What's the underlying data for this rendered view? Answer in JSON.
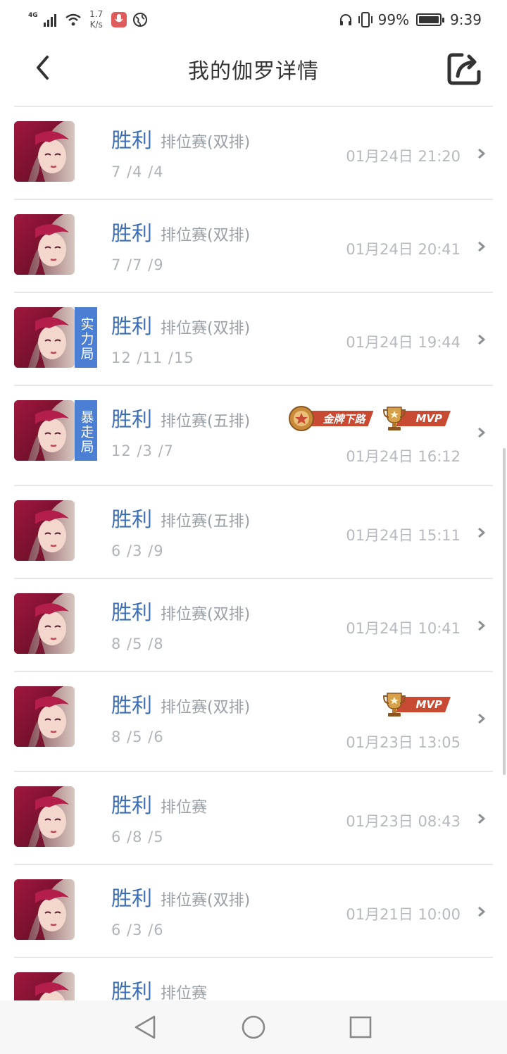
{
  "status_bar": {
    "network": "4G",
    "speed": "1.7",
    "speed_unit": "K/s",
    "battery": "99%",
    "time": "9:39"
  },
  "header": {
    "title": "我的伽罗详情"
  },
  "matches": [
    {
      "result": "胜利",
      "mode": "排位赛(双排)",
      "kda": "7 /4 /4",
      "time": "01月24日 21:20",
      "tag": "",
      "badges": []
    },
    {
      "result": "胜利",
      "mode": "排位赛(双排)",
      "kda": "7 /7 /9",
      "time": "01月24日 20:41",
      "tag": "",
      "badges": []
    },
    {
      "result": "胜利",
      "mode": "排位赛(双排)",
      "kda": "12 /11 /15",
      "time": "01月24日 19:44",
      "tag": "实力局",
      "badges": []
    },
    {
      "result": "胜利",
      "mode": "排位赛(五排)",
      "kda": "12 /3 /7",
      "time": "01月24日 16:12",
      "tag": "暴走局",
      "badges": [
        "金牌下路",
        "MVP"
      ]
    },
    {
      "result": "胜利",
      "mode": "排位赛(五排)",
      "kda": "6 /3 /9",
      "time": "01月24日 15:11",
      "tag": "",
      "badges": []
    },
    {
      "result": "胜利",
      "mode": "排位赛(双排)",
      "kda": "8 /5 /8",
      "time": "01月24日 10:41",
      "tag": "",
      "badges": []
    },
    {
      "result": "胜利",
      "mode": "排位赛(双排)",
      "kda": "8 /5 /6",
      "time": "01月23日 13:05",
      "tag": "",
      "badges": [
        "MVP"
      ]
    },
    {
      "result": "胜利",
      "mode": "排位赛",
      "kda": "6 /8 /5",
      "time": "01月23日 08:43",
      "tag": "",
      "badges": []
    },
    {
      "result": "胜利",
      "mode": "排位赛(双排)",
      "kda": "6 /3 /6",
      "time": "01月21日 10:00",
      "tag": "",
      "badges": []
    },
    {
      "result": "胜利",
      "mode": "排位赛",
      "kda": "",
      "time": "",
      "tag": "",
      "badges": []
    }
  ],
  "icons": {
    "back": "chevron-left-icon",
    "share": "share-icon",
    "nav_back": "triangle-back-icon",
    "nav_home": "circle-home-icon",
    "nav_recent": "square-recent-icon"
  },
  "colors": {
    "result_win": "#3c6eb8",
    "tag_bg": "#4a7fd4",
    "badge_ribbon": "#c84a32"
  }
}
